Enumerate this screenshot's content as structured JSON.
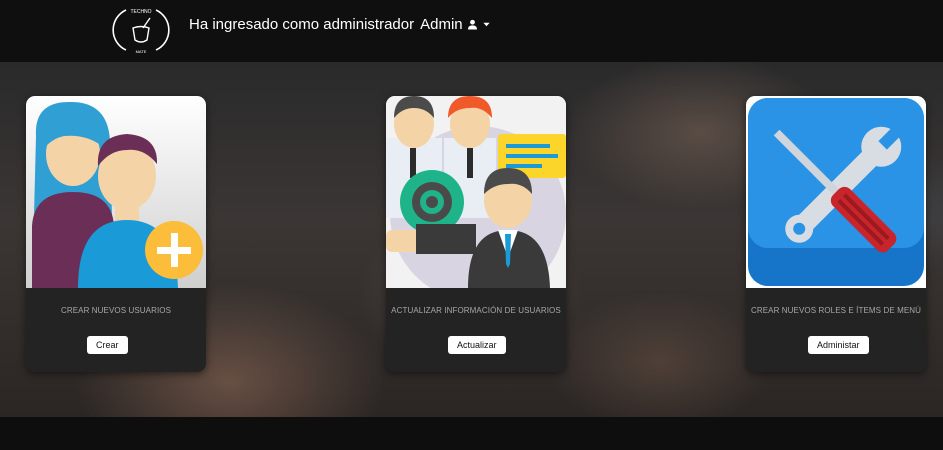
{
  "header": {
    "logo_text_top": "TECHNO",
    "logo_text_bottom": "MATE",
    "logged_in_text": "Ha ingresado como administrador",
    "user_label": "Admin",
    "user_icon": "person-icon",
    "dropdown_icon": "caret-down-icon"
  },
  "cards": [
    {
      "icon": "add-users-illustration",
      "title": "CREAR NUEVOS USUARIOS",
      "button_label": "Crear"
    },
    {
      "icon": "team-update-illustration",
      "title": "ACTUALIZAR INFORMACIÓN DE USUARIOS",
      "button_label": "Actualizar"
    },
    {
      "icon": "tools-illustration",
      "title": "CREAR NUEVOS ROLES E ÍTEMS DE MENÚ",
      "button_label": "Administar"
    }
  ],
  "colors": {
    "card_bg": "#232323",
    "navbar_bg": "#0f0f0f",
    "accent_yellow": "#fbbd3a",
    "accent_blue": "#1a9ad6"
  }
}
